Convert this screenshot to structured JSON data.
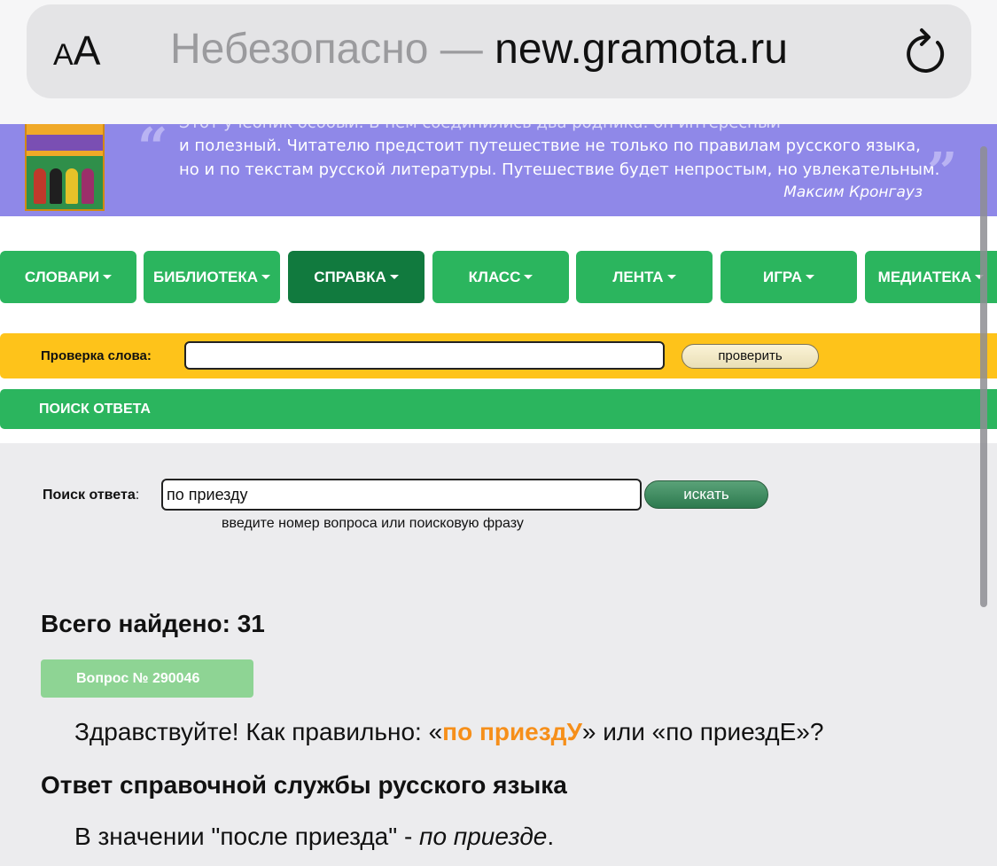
{
  "browser": {
    "aa_small": "A",
    "aa_big": "A",
    "insecure_label": "Небезопасно — ",
    "domain": "new.gramota.ru",
    "reload_icon": "reload-icon"
  },
  "banner": {
    "line0": "Этот учебник особый. В нём соединились два родника: он интересный",
    "line1": "и полезный. Читателю предстоит путешествие не только по правилам русского языка,",
    "line2": "но и по текстам русской литературы. Путешествие будет непростым, но увлекательным.",
    "author": "Максим Кронгауз",
    "book_icon": "book-cover-image",
    "colors": {
      "background": "#8f88e8"
    }
  },
  "nav": {
    "items": [
      {
        "label": "СЛОВАРИ"
      },
      {
        "label": "БИБЛИОТЕКА"
      },
      {
        "label": "СПРАВКА"
      },
      {
        "label": "КЛАСС"
      },
      {
        "label": "ЛЕНТА"
      },
      {
        "label": "ИГРА"
      },
      {
        "label": "МЕДИАТЕКА"
      }
    ],
    "active": "СПРАВКА",
    "colors": {
      "normal": "#2bb55e",
      "active": "#117a3e"
    }
  },
  "word_check": {
    "label": "Проверка слова:",
    "value": "",
    "button": "проверить",
    "colors": {
      "bar": "#fec31a"
    }
  },
  "answer_search": {
    "header": "ПОИСК ОТВЕТА",
    "label_bold": "Поиск ответа",
    "label_colon": ":",
    "value": "по приезду",
    "button": "искать",
    "hint": "введите номер вопроса или поисковую фразу"
  },
  "results": {
    "total": "Всего найдено: 31",
    "question_badge": "Вопрос № 290046",
    "question_pre": "Здравствуйте! Как правильно: «",
    "question_highlight": "по приездУ",
    "question_post": "» или «по приездЕ»?",
    "answer_title": "Ответ справочной службы русского языка",
    "answer_pre": "В значении \"после приезда\" - ",
    "answer_italic": "по приезде",
    "answer_post": ".",
    "colors": {
      "highlight": "#f68f1a",
      "badge": "#8ed494"
    }
  }
}
